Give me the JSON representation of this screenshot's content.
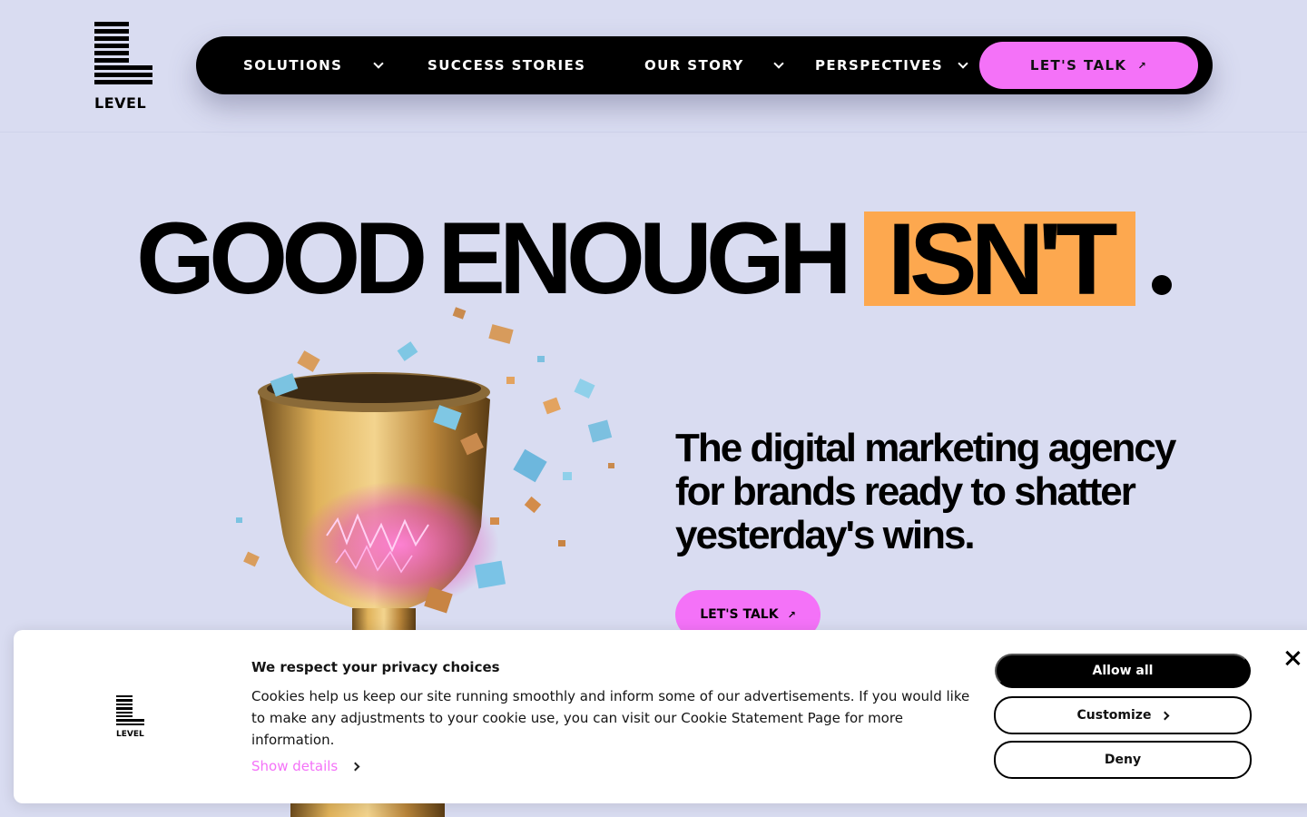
{
  "brand": {
    "logo_text": "LEVEL"
  },
  "nav": {
    "items": [
      {
        "label": "SOLUTIONS",
        "has_dropdown": true
      },
      {
        "label": "SUCCESS STORIES",
        "has_dropdown": false
      },
      {
        "label": "OUR STORY",
        "has_dropdown": true
      },
      {
        "label": "PERSPECTIVES",
        "has_dropdown": true
      }
    ],
    "cta_label": "LET'S TALK",
    "cta_arrow": "↗"
  },
  "hero": {
    "headline_part1": "GOOD",
    "headline_part2": "ENOUGH",
    "headline_highlight": "ISN'T",
    "tagline": "The digital marketing agency for brands ready to shatter yesterday's wins.",
    "cta_label": "LET'S TALK",
    "cta_arrow": "↗"
  },
  "cookie_banner": {
    "logo_text": "LEVEL",
    "title": "We respect your privacy choices",
    "text": "Cookies help us keep our site running smoothly and inform some of our advertisements. If you would like to make any adjustments to your cookie use, you can visit our Cookie Statement Page for more information.",
    "show_details": "Show details",
    "allow_all": "Allow all",
    "customize": "Customize",
    "deny": "Deny"
  },
  "colors": {
    "background": "#d9dcf1",
    "pink_accent": "#f472f8",
    "orange_highlight": "#fda84f",
    "nav_bg": "#000000"
  },
  "icons": [
    "chevron-down-icon",
    "arrow-up-right-icon",
    "chevron-right-icon",
    "close-icon"
  ]
}
